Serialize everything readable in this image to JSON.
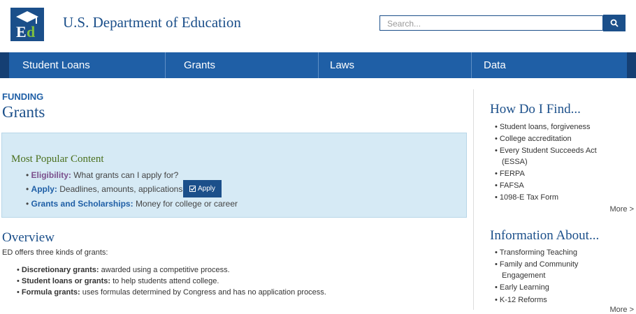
{
  "header": {
    "logo_text": "Ed",
    "site_title": "U.S. Department of Education",
    "search_placeholder": "Search...",
    "search_icon": "search-icon"
  },
  "nav": {
    "items": [
      {
        "label": "Student Loans"
      },
      {
        "label": "Grants"
      },
      {
        "label": "Laws"
      },
      {
        "label": "Data"
      }
    ]
  },
  "main": {
    "eyebrow": "FUNDING",
    "title": "Grants",
    "popular": {
      "title": "Most Popular Content",
      "items": [
        {
          "lead": "Eligibility:",
          "text": "What grants can I apply for?"
        },
        {
          "lead": "Apply:",
          "text": "Deadlines, amounts, applications"
        },
        {
          "lead": "Grants and Scholarships:",
          "text": "Money for college or career"
        }
      ],
      "apply_button": "Apply",
      "apply_icon": "edit-check-icon"
    },
    "overview": {
      "title": "Overview",
      "intro": "ED offers three kinds of grants:",
      "items": [
        {
          "lead": "Discretionary grants:",
          "text": "awarded using a competitive process."
        },
        {
          "lead": "Student loans or grants:",
          "text": "to help students attend college."
        },
        {
          "lead": "Formula grants:",
          "text": "uses formulas determined by Congress and has no application process."
        }
      ]
    }
  },
  "sidebar": {
    "find": {
      "title": "How Do I Find...",
      "items": [
        "Student loans, forgiveness",
        "College accreditation",
        "Every Student Succeeds Act",
        "(ESSA)",
        "FERPA",
        "FAFSA",
        "1098-E Tax Form"
      ],
      "more": "More >"
    },
    "info": {
      "title": "Information About...",
      "items": [
        "Transforming Teaching",
        "Family and Community",
        "Engagement",
        "Early Learning",
        "K-12 Reforms"
      ],
      "more": "More >"
    }
  },
  "colors": {
    "brand_blue": "#1b4f8a",
    "nav_blue": "#1f5fa6",
    "popular_bg": "#d6eaf5",
    "popular_title": "#4a6f1d",
    "eligibility_link": "#7b4f8c"
  }
}
